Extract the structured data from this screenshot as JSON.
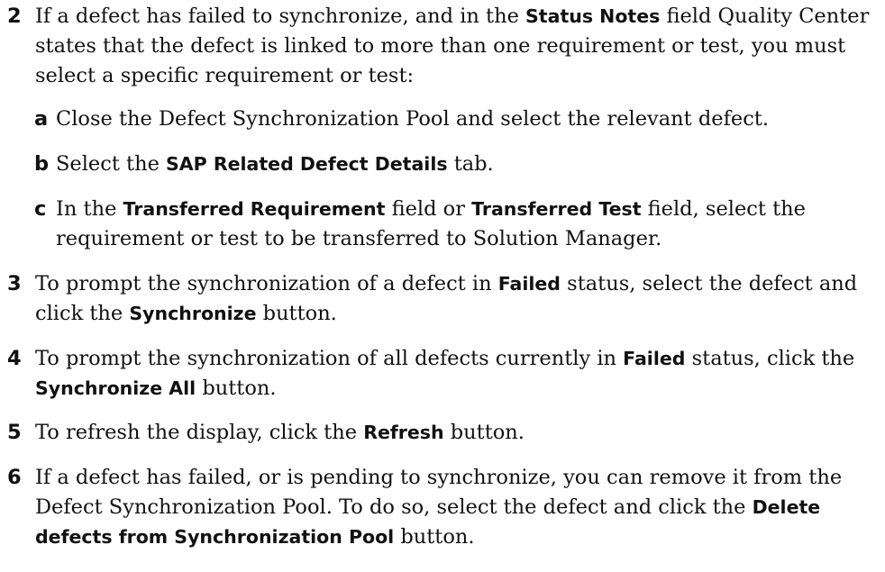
{
  "steps": {
    "s2": {
      "number": "2",
      "t1": "If a defect has failed to synchronize, and in the ",
      "b1": "Status Notes",
      "t2": " field Quality Center states that the defect is linked to more than one requirement or test, you must select a specific requirement or test:"
    },
    "s2a": {
      "letter": "a",
      "t1": "Close the Defect Synchronization Pool and select the relevant defect."
    },
    "s2b": {
      "letter": "b",
      "t1": "Select the ",
      "b1": "SAP Related Defect Details",
      "t2": " tab."
    },
    "s2c": {
      "letter": "c",
      "t1": "In the ",
      "b1": "Transferred Requirement",
      "t2": " field or ",
      "b2": "Transferred Test",
      "t3": " field, select the requirement or test to be transferred to Solution Manager."
    },
    "s3": {
      "number": "3",
      "t1": "To prompt the synchronization of a defect in ",
      "b1": "Failed",
      "t2": " status, select the defect and click the ",
      "b2": "Synchronize",
      "t3": " button."
    },
    "s4": {
      "number": "4",
      "t1": "To prompt the synchronization of all defects currently in ",
      "b1": "Failed",
      "t2": " status, click the ",
      "b2": "Synchronize All",
      "t3": " button."
    },
    "s5": {
      "number": "5",
      "t1": "To refresh the display, click the ",
      "b1": "Refresh",
      "t2": " button."
    },
    "s6": {
      "number": "6",
      "t1": "If a defect has failed, or is pending to synchronize, you can remove it from the Defect Synchronization Pool. To do so, select the defect and click the ",
      "b1": "Delete defects from Synchronization Pool",
      "t2": " button."
    }
  }
}
